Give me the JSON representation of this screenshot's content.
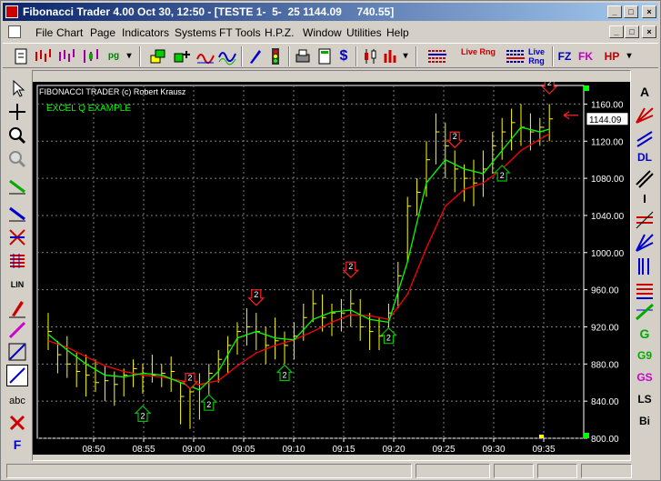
{
  "window": {
    "title": "Fibonacci Trader 4.00 Oct 30, 12:50 - [TESTE 1-  5-  25 1144.09     740.55]",
    "minimize": "_",
    "maximize": "□",
    "close": "×",
    "doc_min": "_",
    "doc_max": "□",
    "doc_close": "×"
  },
  "menu": [
    "File",
    "Chart",
    "Page",
    "Indicators",
    "Systems",
    "FT Tools",
    "H.P.Z.",
    "Window",
    "Utilities",
    "Help"
  ],
  "toolbar": {
    "pg": "pg",
    "dollar": "$",
    "live_rng_1": "Live Rng",
    "live_rng_2": "Live Rng",
    "fz": "FZ",
    "fk": "FK",
    "hp": "HP"
  },
  "left_tools": [
    "cursor-icon",
    "crosshair-icon",
    "zoom-in-icon",
    "zoom-out-icon",
    "green-line-icon",
    "blue-line-icon",
    "cross-lines-icon",
    "grid-icon",
    "lin-icon",
    "pencil-icon",
    "magenta-line-icon",
    "diagonal-icon",
    "diagonal-selected-icon",
    "abc",
    "eraser-icon",
    "F"
  ],
  "left_labels": {
    "lin": "LIN",
    "abc": "abc",
    "f": "F"
  },
  "right_labels": {
    "a": "A",
    "dl": "DL",
    "i": "I",
    "g": "G",
    "g9": "G9",
    "gs": "GS",
    "ls": "LS",
    "bi": "Bi"
  },
  "chart_data": {
    "type": "line",
    "title": "FIBONACCI TRADER (c) Robert Krausz",
    "subtitle": "EXCEL Q EXAMPLE",
    "last_price_label": "1144.09",
    "ylim": [
      800,
      1180
    ],
    "yticks": [
      "1160.00",
      "1120.00",
      "1080.00",
      "1040.00",
      "1000.00",
      "960.00",
      "920.00",
      "880.00",
      "840.00",
      "800.00"
    ],
    "xticks": [
      "08:50",
      "08:55",
      "09:00",
      "09:05",
      "09:10",
      "09:15",
      "09:20",
      "09:25",
      "09:30",
      "09:35"
    ],
    "grid": true,
    "colors": {
      "bars": "#ffff00",
      "fast": "#00ff00",
      "slow": "#ff0000",
      "green_marker": "#00c000",
      "red_marker": "#ff2020"
    },
    "bars": [
      [
        0,
        935,
        895,
        915
      ],
      [
        1,
        905,
        870,
        890
      ],
      [
        2,
        910,
        865,
        880
      ],
      [
        3,
        892,
        855,
        872
      ],
      [
        4,
        890,
        845,
        868
      ],
      [
        5,
        885,
        850,
        860
      ],
      [
        6,
        878,
        840,
        862
      ],
      [
        7,
        872,
        835,
        858
      ],
      [
        8,
        875,
        845,
        868
      ],
      [
        9,
        885,
        855,
        875
      ],
      [
        10,
        880,
        848,
        870
      ],
      [
        11,
        890,
        860,
        868
      ],
      [
        12,
        880,
        855,
        870
      ],
      [
        13,
        888,
        850,
        872
      ],
      [
        14,
        860,
        815,
        845
      ],
      [
        15,
        865,
        810,
        850
      ],
      [
        16,
        870,
        820,
        858
      ],
      [
        17,
        880,
        835,
        870
      ],
      [
        18,
        895,
        860,
        885
      ],
      [
        19,
        910,
        870,
        900
      ],
      [
        20,
        925,
        890,
        915
      ],
      [
        21,
        940,
        900,
        920
      ],
      [
        22,
        935,
        895,
        915
      ],
      [
        23,
        920,
        880,
        900
      ],
      [
        24,
        930,
        885,
        905
      ],
      [
        25,
        915,
        880,
        900
      ],
      [
        26,
        925,
        885,
        910
      ],
      [
        27,
        945,
        905,
        930
      ],
      [
        28,
        960,
        925,
        945
      ],
      [
        29,
        955,
        915,
        930
      ],
      [
        30,
        945,
        910,
        935
      ],
      [
        31,
        950,
        915,
        935
      ],
      [
        32,
        960,
        920,
        945
      ],
      [
        33,
        950,
        905,
        920
      ],
      [
        34,
        935,
        895,
        915
      ],
      [
        35,
        930,
        895,
        910
      ],
      [
        36,
        945,
        905,
        935
      ],
      [
        37,
        990,
        940,
        975
      ],
      [
        38,
        1060,
        990,
        1050
      ],
      [
        39,
        1080,
        1040,
        1065
      ],
      [
        40,
        1120,
        1060,
        1100
      ],
      [
        41,
        1150,
        1095,
        1130
      ],
      [
        42,
        1140,
        1080,
        1115
      ],
      [
        43,
        1110,
        1065,
        1090
      ],
      [
        44,
        1095,
        1055,
        1080
      ],
      [
        45,
        1100,
        1050,
        1075
      ],
      [
        46,
        1110,
        1060,
        1090
      ],
      [
        47,
        1130,
        1085,
        1115
      ],
      [
        48,
        1145,
        1100,
        1130
      ],
      [
        49,
        1155,
        1110,
        1140
      ],
      [
        50,
        1160,
        1115,
        1135
      ],
      [
        51,
        1150,
        1110,
        1130
      ],
      [
        52,
        1145,
        1115,
        1135
      ],
      [
        53,
        1160,
        1120,
        1144
      ]
    ],
    "fast_line": [
      [
        0,
        912
      ],
      [
        2,
        895
      ],
      [
        4,
        880
      ],
      [
        6,
        868
      ],
      [
        8,
        866
      ],
      [
        10,
        870
      ],
      [
        12,
        868
      ],
      [
        14,
        860
      ],
      [
        16,
        852
      ],
      [
        18,
        872
      ],
      [
        20,
        908
      ],
      [
        22,
        915
      ],
      [
        24,
        908
      ],
      [
        26,
        906
      ],
      [
        28,
        928
      ],
      [
        30,
        936
      ],
      [
        32,
        938
      ],
      [
        34,
        928
      ],
      [
        36,
        925
      ],
      [
        38,
        990
      ],
      [
        40,
        1075
      ],
      [
        42,
        1100
      ],
      [
        44,
        1090
      ],
      [
        46,
        1085
      ],
      [
        48,
        1110
      ],
      [
        50,
        1135
      ],
      [
        52,
        1130
      ],
      [
        53,
        1133
      ]
    ],
    "slow_line": [
      [
        0,
        905
      ],
      [
        2,
        898
      ],
      [
        4,
        888
      ],
      [
        6,
        878
      ],
      [
        8,
        872
      ],
      [
        10,
        868
      ],
      [
        12,
        866
      ],
      [
        14,
        862
      ],
      [
        16,
        858
      ],
      [
        18,
        862
      ],
      [
        20,
        878
      ],
      [
        22,
        892
      ],
      [
        24,
        900
      ],
      [
        26,
        906
      ],
      [
        28,
        915
      ],
      [
        30,
        925
      ],
      [
        32,
        933
      ],
      [
        34,
        932
      ],
      [
        36,
        928
      ],
      [
        38,
        955
      ],
      [
        40,
        1005
      ],
      [
        42,
        1050
      ],
      [
        44,
        1068
      ],
      [
        46,
        1075
      ],
      [
        48,
        1090
      ],
      [
        50,
        1110
      ],
      [
        52,
        1122
      ],
      [
        53,
        1128
      ]
    ],
    "markers": [
      {
        "bar": 10,
        "price": 826,
        "dir": "up",
        "color": "green",
        "label": "2"
      },
      {
        "bar": 15,
        "price": 862,
        "dir": "down",
        "color": "red",
        "label": "2"
      },
      {
        "bar": 17,
        "price": 838,
        "dir": "up",
        "color": "green",
        "label": "2"
      },
      {
        "bar": 22,
        "price": 952,
        "dir": "down",
        "color": "red",
        "label": "2"
      },
      {
        "bar": 25,
        "price": 870,
        "dir": "up",
        "color": "green",
        "label": "2"
      },
      {
        "bar": 32,
        "price": 982,
        "dir": "down",
        "color": "red",
        "label": "2"
      },
      {
        "bar": 36,
        "price": 910,
        "dir": "up",
        "color": "green",
        "label": "2"
      },
      {
        "bar": 43,
        "price": 1122,
        "dir": "down",
        "color": "red",
        "label": "2"
      },
      {
        "bar": 48,
        "price": 1085,
        "dir": "up",
        "color": "green",
        "label": "2"
      },
      {
        "bar": 53,
        "price": 1180,
        "dir": "down",
        "color": "red",
        "label": "2"
      }
    ]
  }
}
